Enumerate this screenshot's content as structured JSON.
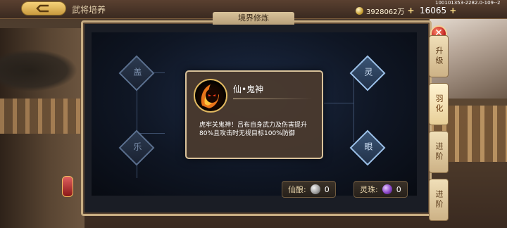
{
  "topbar": {
    "title": "武将培养",
    "gold": "3928062万",
    "gems": "16065",
    "build_id": "100101353-2282.0-109--2"
  },
  "panel": {
    "title": "境界修炼",
    "nodes": {
      "n1": "盖",
      "n2": "乐",
      "n3": "灵",
      "n4": "眼"
    },
    "currency1": {
      "label": "仙酿:",
      "count": "0"
    },
    "currency2": {
      "label": "灵珠:",
      "count": "0"
    }
  },
  "side_tabs": [
    {
      "label": "升级"
    },
    {
      "label": "羽化"
    },
    {
      "label": "进阶"
    },
    {
      "label": "进阶"
    }
  ],
  "popup": {
    "skill_name": "仙•鬼神",
    "description": "虎牢关鬼神！吕布自身武力及伤害提升80%且攻击时无视目标100%防御"
  },
  "colors": {
    "panel_border": "#c8ad82",
    "popup_bg": "#4a3a2e",
    "accent_gold": "#e0b860"
  }
}
